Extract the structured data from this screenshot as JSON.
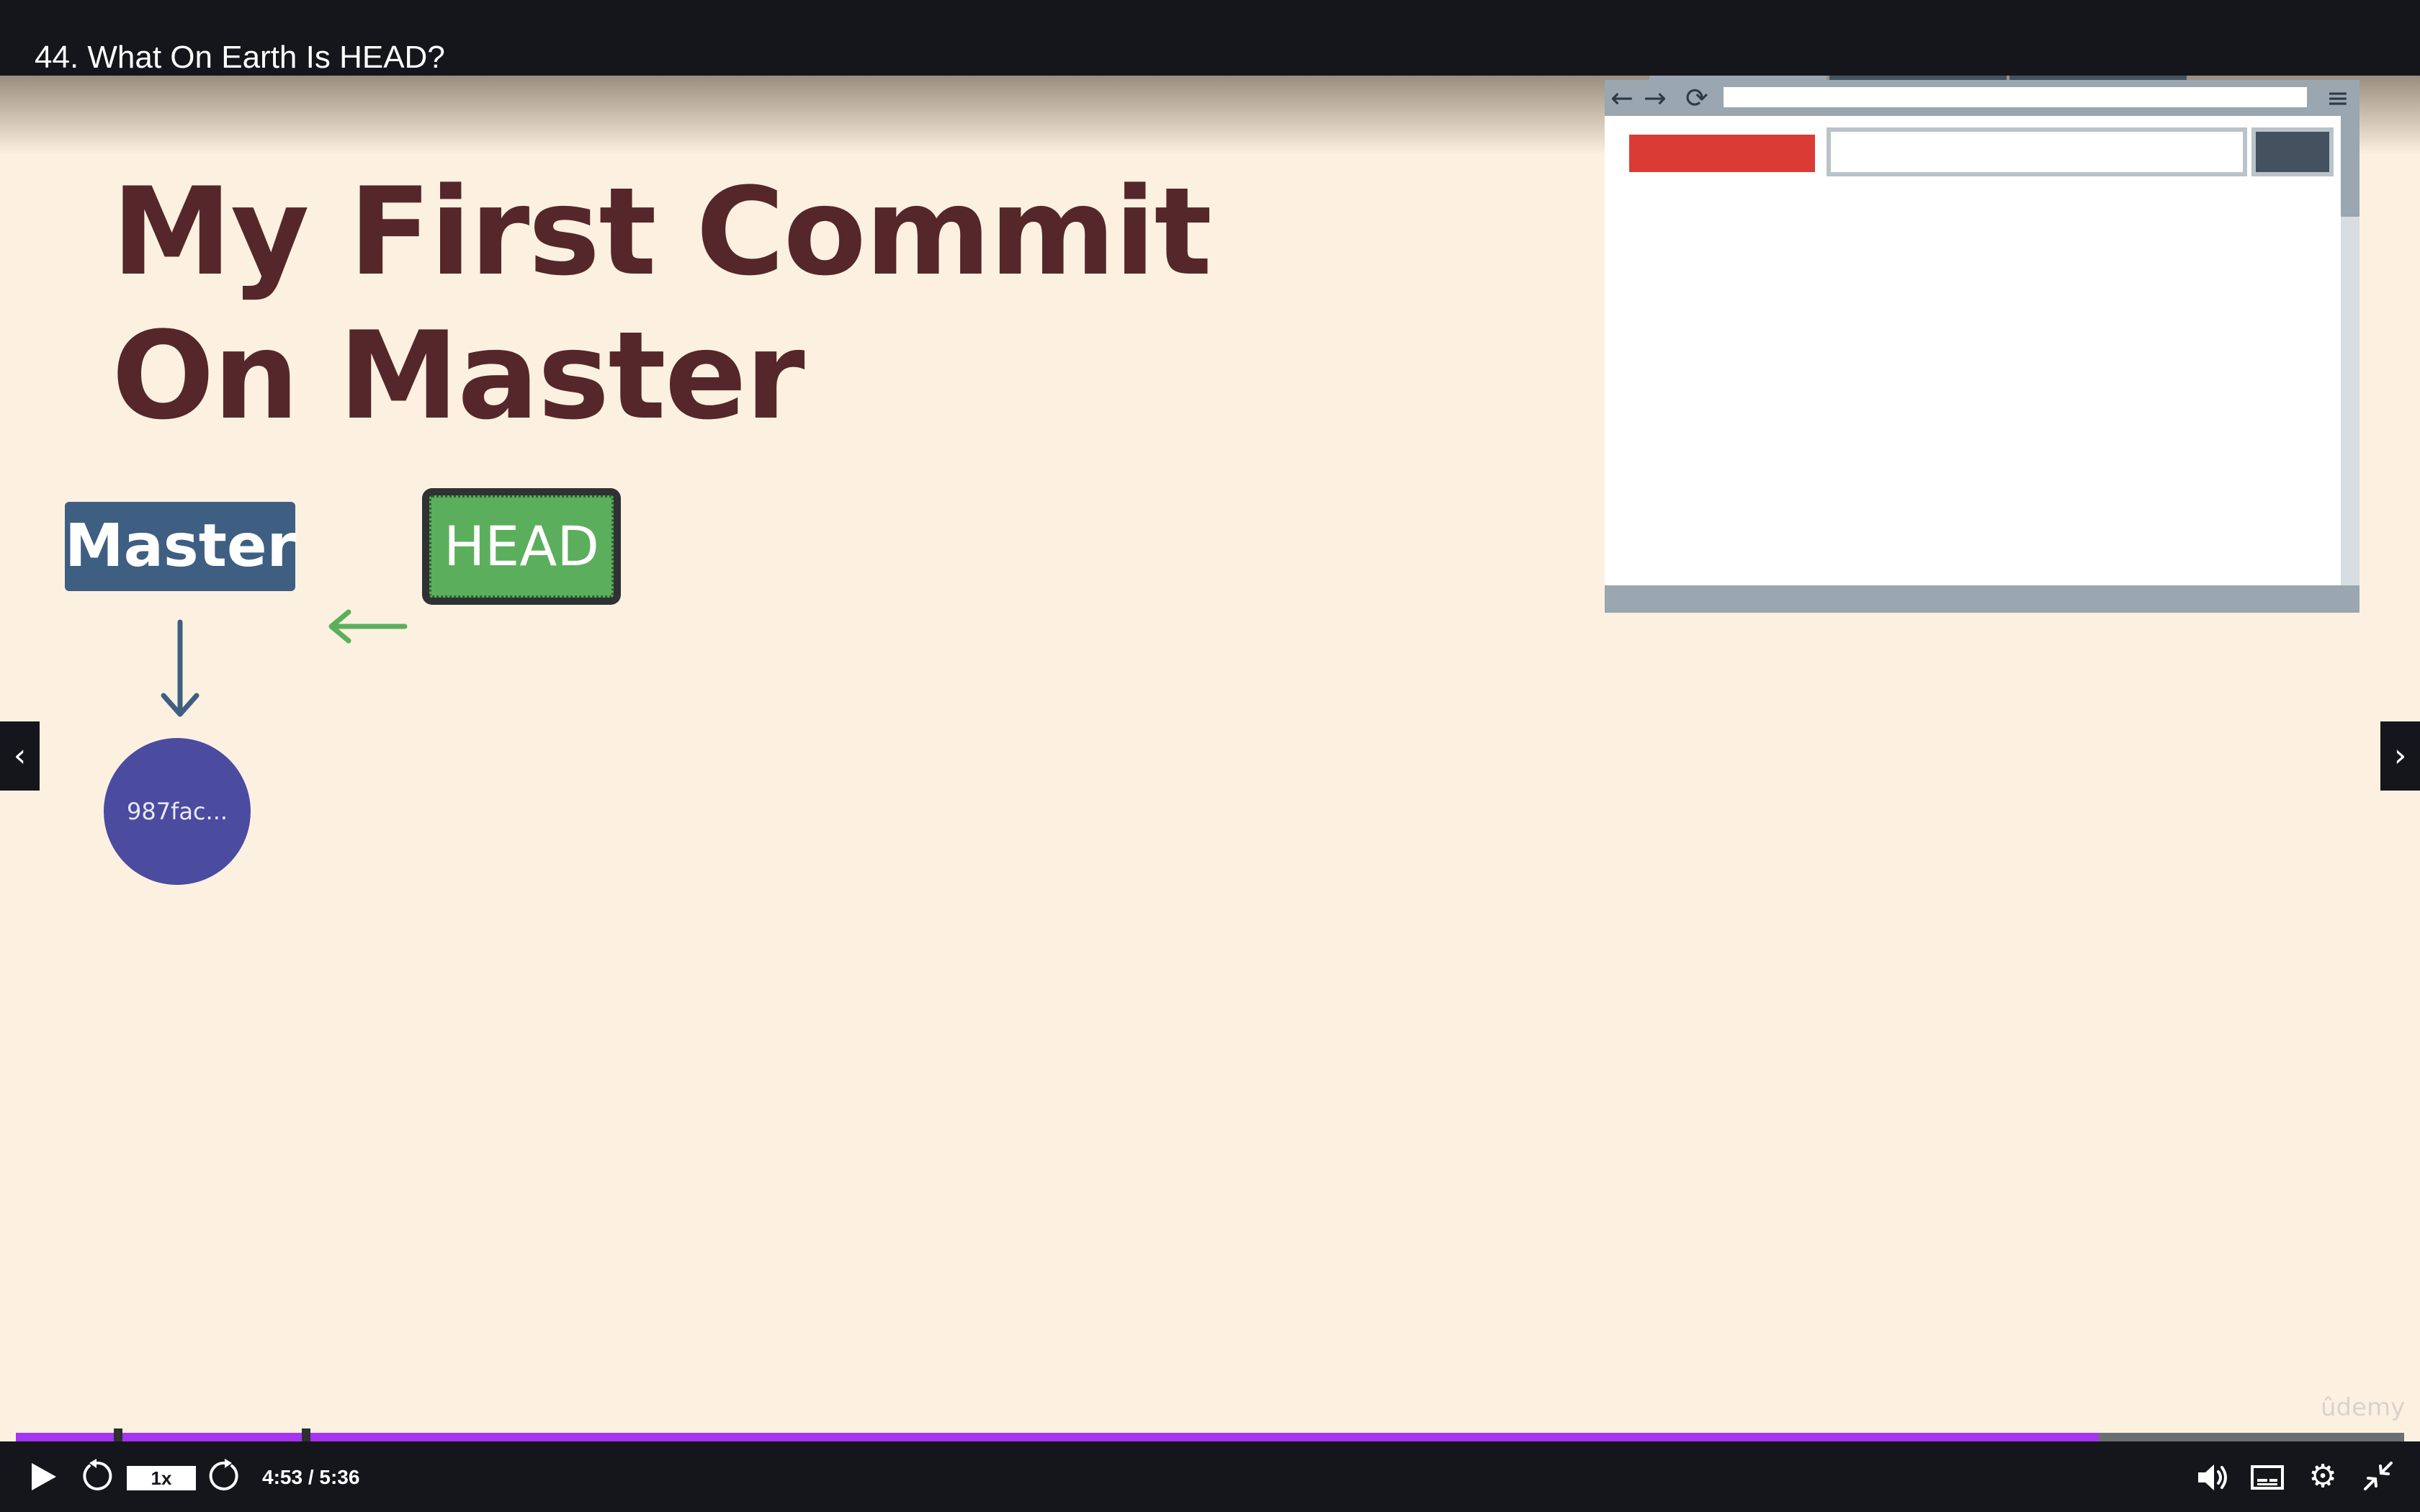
{
  "header": {
    "lecture_title": "44. What On Earth Is HEAD?"
  },
  "slide": {
    "title_line1": "My First Commit",
    "title_line2": "On Master",
    "branch_label": "Master",
    "head_label": "HEAD",
    "commit_hash": "987fac...",
    "colors": {
      "title": "#55272a",
      "branch": "#3e5f81",
      "head": "#5baf5c",
      "commit": "#4b4ba0",
      "arrow_head": "#5baf5c",
      "arrow_branch": "#3e5f81"
    }
  },
  "browser_illustration": {
    "tab_count": 3,
    "tab_close_glyph": "×",
    "icons": [
      "back-arrow-icon",
      "forward-arrow-icon",
      "reload-icon",
      "hamburger-menu-icon"
    ],
    "colors": {
      "chrome": "#9aa6b0",
      "tab_dark": "#44525f",
      "logo": "#da3b35"
    }
  },
  "navigation": {
    "prev_glyph": "‹",
    "next_glyph": "›"
  },
  "watermark": "ûdemy",
  "player": {
    "speed": "1x",
    "time": "4:53 / 5:36",
    "current_seconds": 293,
    "duration_seconds": 336,
    "progress_fraction": 0.872,
    "chapter_marker_fractions": [
      0.0428,
      0.1215
    ],
    "accent_color": "#a435f0",
    "icons": [
      "play-icon",
      "rewind-icon",
      "forward-icon",
      "volume-icon",
      "captions-icon",
      "settings-icon",
      "exit-fullscreen-icon"
    ]
  }
}
